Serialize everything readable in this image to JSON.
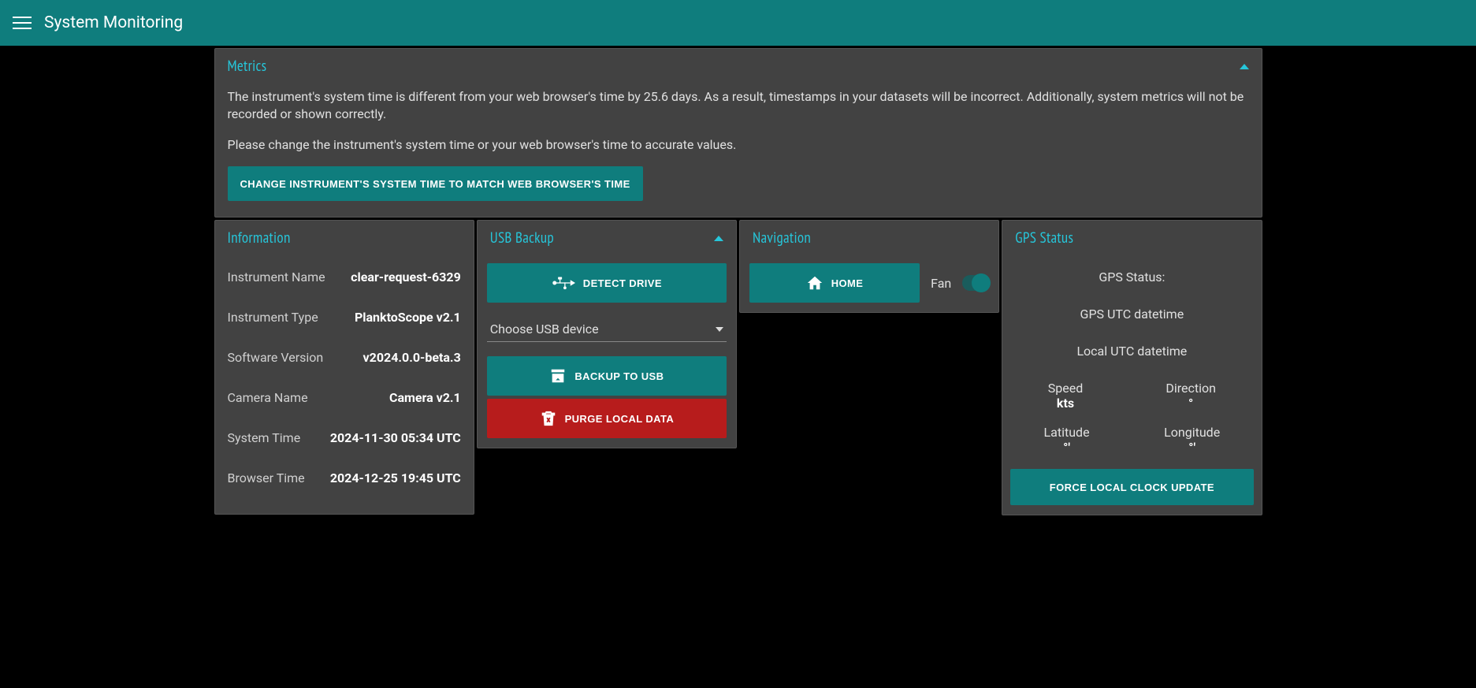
{
  "topbar": {
    "title": "System Monitoring"
  },
  "metrics": {
    "title": "Metrics",
    "warning1": "The instrument's system time is different from your web browser's time by 25.6 days. As a result, timestamps in your datasets will be incorrect. Additionally, system metrics will not be recorded or shown correctly.",
    "warning2": "Please change the instrument's system time or your web browser's time to accurate values.",
    "change_time_button": "CHANGE INSTRUMENT'S SYSTEM TIME TO MATCH WEB BROWSER'S TIME"
  },
  "information": {
    "title": "Information",
    "rows": [
      {
        "label": "Instrument Name",
        "value": "clear-request-6329"
      },
      {
        "label": "Instrument Type",
        "value": "PlanktoScope v2.1"
      },
      {
        "label": "Software Version",
        "value": "v2024.0.0-beta.3"
      },
      {
        "label": "Camera Name",
        "value": "Camera v2.1"
      },
      {
        "label": "System Time",
        "value": "2024-11-30 05:34 UTC"
      },
      {
        "label": "Browser Time",
        "value": "2024-12-25 19:45 UTC"
      }
    ]
  },
  "usb": {
    "title": "USB Backup",
    "detect_button": "DETECT DRIVE",
    "select_placeholder": "Choose USB device",
    "backup_button": "BACKUP TO USB",
    "purge_button": "PURGE LOCAL DATA"
  },
  "navigation": {
    "title": "Navigation",
    "home_button": "HOME",
    "fan_label": "Fan",
    "fan_on": true
  },
  "gps": {
    "title": "GPS Status",
    "status_label": "GPS Status:",
    "status_value": "",
    "utc_label": "GPS UTC datetime",
    "utc_value": "",
    "local_label": "Local UTC datetime",
    "local_value": "",
    "speed_label": "Speed",
    "speed_value": "kts",
    "direction_label": "Direction",
    "direction_value": "°",
    "latitude_label": "Latitude",
    "latitude_value": "°'",
    "longitude_label": "Longitude",
    "longitude_value": "°'",
    "force_button": "FORCE LOCAL CLOCK UPDATE"
  }
}
